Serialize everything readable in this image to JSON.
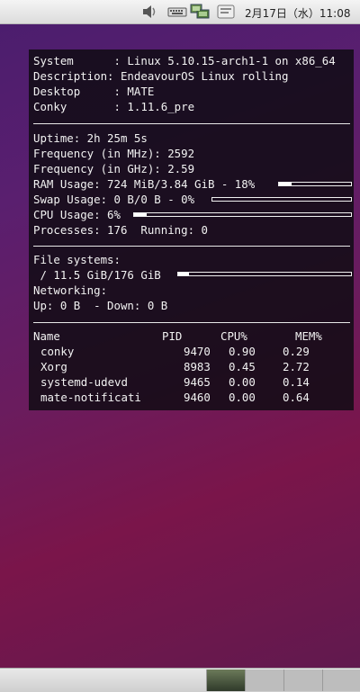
{
  "top_panel": {
    "clock": "2月17日（水）11:08",
    "icons": [
      "volume-icon",
      "keyboard-icon",
      "network-icon",
      "notification-icon"
    ]
  },
  "conky": {
    "system": {
      "system": "System      : Linux 5.10.15-arch1-1 on x86_64",
      "description": "Description: EndeavourOS Linux rolling",
      "desktop": "Desktop     : MATE",
      "conky": "Conky       : 1.11.6_pre"
    },
    "stats": {
      "uptime": "Uptime: 2h 25m 5s",
      "freq_mhz": "Frequency (in MHz): 2592",
      "freq_ghz": "Frequency (in GHz): 2.59",
      "ram": "RAM Usage: 724 MiB/3.84 GiB - 18%",
      "ram_percent": 18,
      "swap": "Swap Usage: 0 B/0 B - 0%",
      "swap_percent": 0,
      "cpu": "CPU Usage: 6%",
      "cpu_percent": 6,
      "processes": "Processes: 176  Running: 0"
    },
    "fs": {
      "title": "File systems:",
      "root": " / 11.5 GiB/176 GiB",
      "root_percent": 6.5,
      "net_title": "Networking:",
      "net": "Up: 0 B  - Down: 0 B"
    },
    "procs": {
      "headers": {
        "name": "Name",
        "pid": "PID",
        "cpu": "CPU%",
        "mem": "MEM%"
      },
      "rows": [
        {
          "name": "conky",
          "pid": "9470",
          "cpu": "0.90",
          "mem": "0.29"
        },
        {
          "name": "Xorg",
          "pid": "8983",
          "cpu": "0.45",
          "mem": "2.72"
        },
        {
          "name": "systemd-udevd",
          "pid": "9465",
          "cpu": "0.00",
          "mem": "0.14"
        },
        {
          "name": "mate-notificati",
          "pid": "9460",
          "cpu": "0.00",
          "mem": "0.64"
        }
      ]
    }
  },
  "colors": {
    "accent": "#ffffff",
    "panel": "#100c14"
  }
}
